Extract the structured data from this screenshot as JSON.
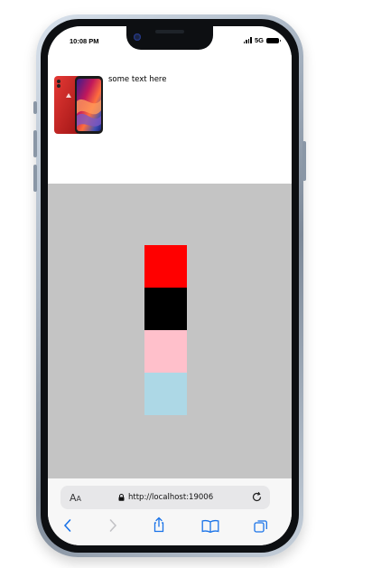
{
  "status_bar": {
    "time": "10:08 PM",
    "network": "5G"
  },
  "page": {
    "caption": "some text here",
    "swatches": [
      {
        "name": "red",
        "color": "#ff0000"
      },
      {
        "name": "black",
        "color": "#000000"
      },
      {
        "name": "pink",
        "color": "#ffc0cb"
      },
      {
        "name": "light-blue",
        "color": "#add8e6"
      }
    ],
    "background_color": "#c4c4c4"
  },
  "browser": {
    "text_size_label": "AA",
    "url": "http://localhost:19006",
    "toolbar": [
      "back-icon",
      "forward-icon",
      "share-icon",
      "bookmarks-icon",
      "tabs-icon"
    ],
    "accent_color": "#1a73e8"
  }
}
